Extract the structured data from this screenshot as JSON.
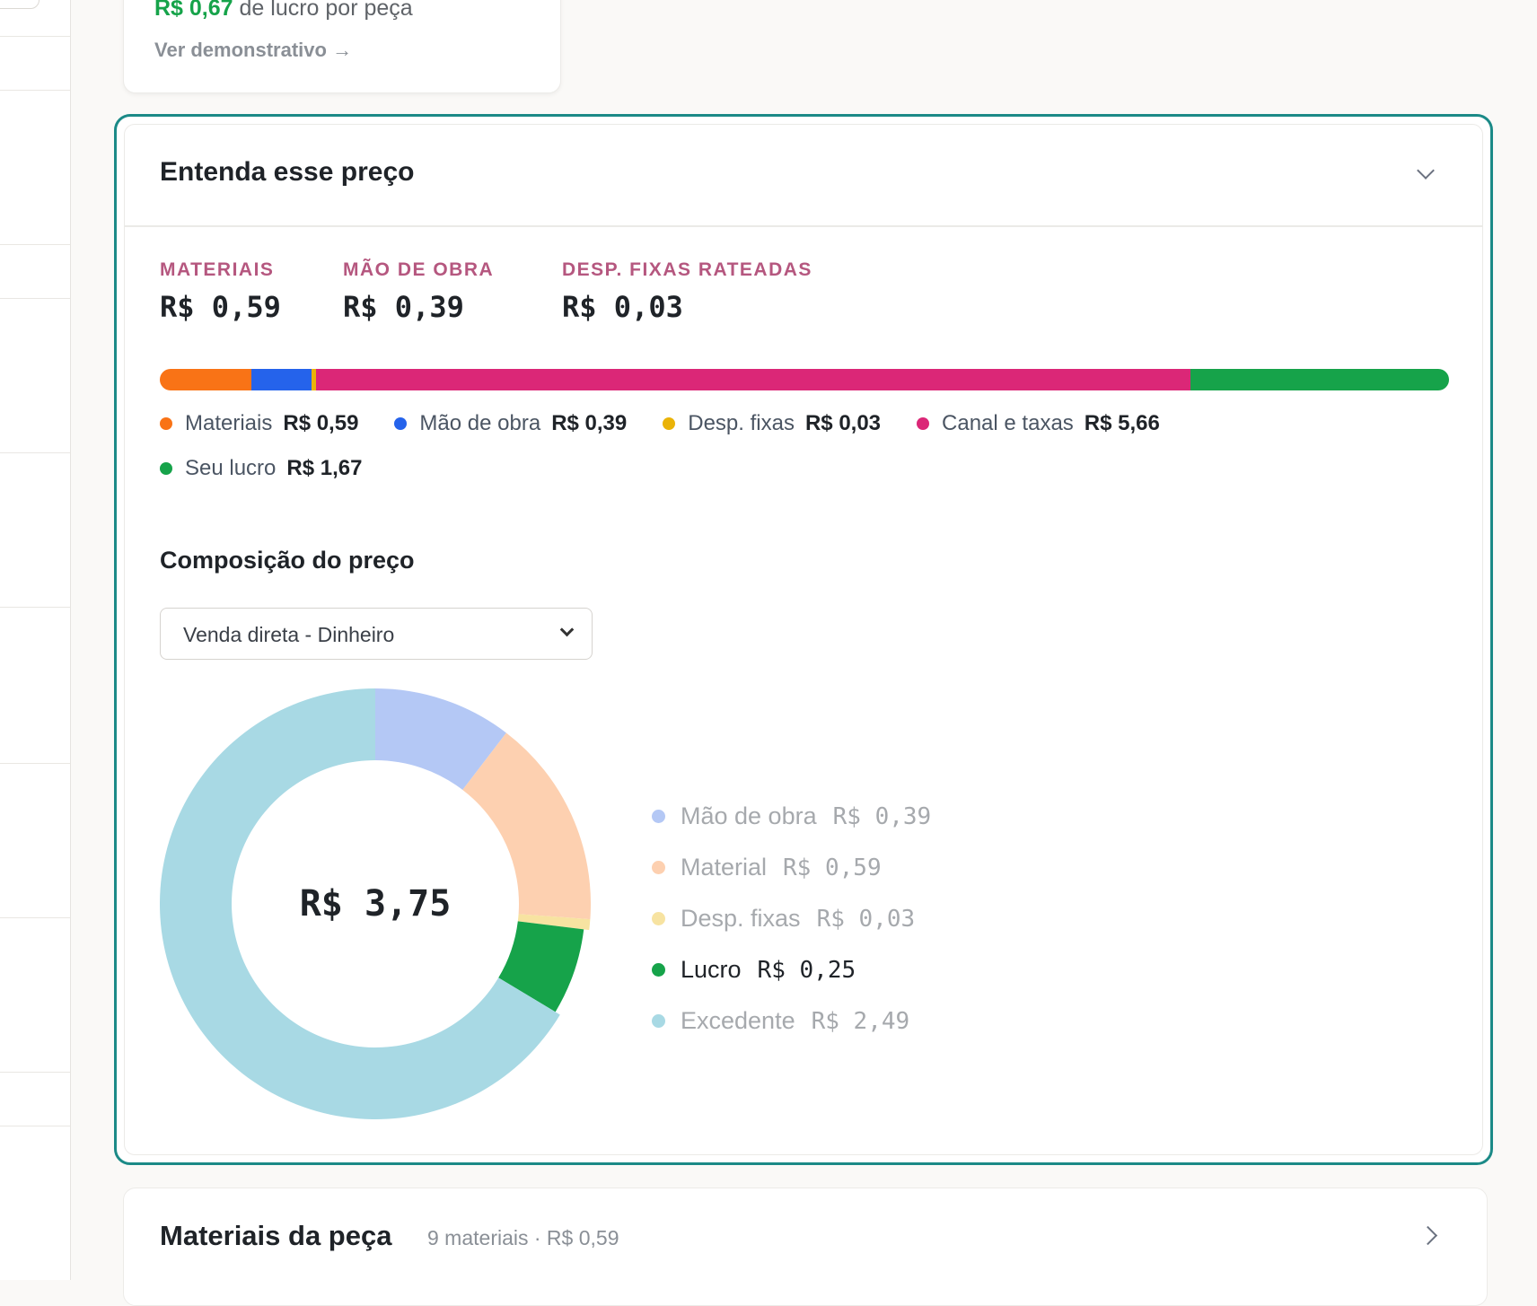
{
  "top_card": {
    "profit_amount": "R$ 0,67",
    "profit_suffix": "de lucro por peça",
    "statement_link": "Ver demonstrativo →"
  },
  "panel": {
    "title": "Entenda esse preço",
    "summary": [
      {
        "label": "MATERIAIS",
        "value": "R$ 0,59"
      },
      {
        "label": "MÃO DE OBRA",
        "value": "R$ 0,39"
      },
      {
        "label": "DESP. FIXAS RATEADAS",
        "value": "R$ 0,03"
      }
    ],
    "breakdown": [
      {
        "name": "Materiais",
        "amount": "R$ 0,59",
        "value": 0.59,
        "color": "#f97316"
      },
      {
        "name": "Mão de obra",
        "amount": "R$ 0,39",
        "value": 0.39,
        "color": "#2563eb"
      },
      {
        "name": "Desp. fixas",
        "amount": "R$ 0,03",
        "value": 0.03,
        "color": "#eab308"
      },
      {
        "name": "Canal e taxas",
        "amount": "R$ 5,66",
        "value": 5.66,
        "color": "#db2777"
      },
      {
        "name": "Seu lucro",
        "amount": "R$ 1,67",
        "value": 1.67,
        "color": "#16a34a"
      }
    ],
    "composition": {
      "title": "Composição do preço",
      "selected_channel": "Venda direta - Dinheiro",
      "total": "R$ 3,75"
    }
  },
  "chart_data": {
    "type": "pie",
    "categories": [
      "Mão de obra",
      "Material",
      "Desp. fixas",
      "Lucro",
      "Excedente"
    ],
    "values": [
      0.39,
      0.59,
      0.03,
      0.25,
      2.49
    ],
    "labels": [
      "R$ 0,39",
      "R$ 0,59",
      "R$ 0,03",
      "R$ 0,25",
      "R$ 2,49"
    ],
    "colors": [
      "#b4c8f5",
      "#fdd0b0",
      "#f7e3a1",
      "#16a34a",
      "#a8d9e4"
    ],
    "highlighted": "Lucro",
    "center_label": "R$ 3,75"
  },
  "materials_card": {
    "title": "Materiais da peça",
    "meta": "9 materiais · R$ 0,59"
  }
}
